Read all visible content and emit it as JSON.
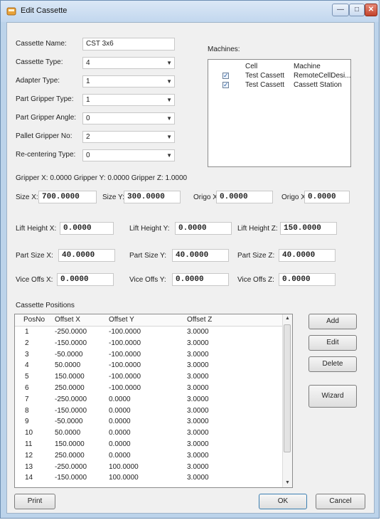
{
  "window": {
    "title": "Edit Cassette"
  },
  "fields": {
    "cassette_name": {
      "label": "Cassette Name:",
      "value": "CST 3x6"
    },
    "cassette_type": {
      "label": "Cassette Type:",
      "value": "4"
    },
    "adapter_type": {
      "label": "Adapter Type:",
      "value": "1"
    },
    "part_gripper_type": {
      "label": "Part Gripper Type:",
      "value": "1"
    },
    "part_gripper_angle": {
      "label": "Part Gripper Angle:",
      "value": "0"
    },
    "pallet_gripper_no": {
      "label": "Pallet Gripper No:",
      "value": "2"
    },
    "recentering_type": {
      "label": "Re-centering Type:",
      "value": "0"
    }
  },
  "machines": {
    "label": "Machines:",
    "columns": [
      "Cell",
      "Machine"
    ],
    "rows": [
      {
        "checked": true,
        "cell": "Test Cassett",
        "machine": "RemoteCellDesi..."
      },
      {
        "checked": true,
        "cell": "Test Cassett",
        "machine": "Cassett Station"
      }
    ]
  },
  "gripper_info": "Gripper X: 0.0000  Gripper Y: 0.0000  Gripper Z: 1.0000",
  "size": {
    "size_x": {
      "label": "Size X:",
      "value": "700.0000"
    },
    "size_y": {
      "label": "Size Y:",
      "value": "300.0000"
    },
    "origo_x": {
      "label": "Origo X:",
      "value": "0.0000"
    },
    "origo_x2": {
      "label": "Origo X:",
      "value": "0.0000"
    }
  },
  "lift": {
    "x": {
      "label": "Lift Height X:",
      "value": "0.0000"
    },
    "y": {
      "label": "Lift Height Y:",
      "value": "0.0000"
    },
    "z": {
      "label": "Lift Height Z:",
      "value": "150.0000"
    }
  },
  "part_size": {
    "x": {
      "label": "Part Size X:",
      "value": "40.0000"
    },
    "y": {
      "label": "Part Size Y:",
      "value": "40.0000"
    },
    "z": {
      "label": "Part Size Z:",
      "value": "40.0000"
    }
  },
  "vice": {
    "x": {
      "label": "Vice Offs X:",
      "value": "0.0000"
    },
    "y": {
      "label": "Vice Offs Y:",
      "value": "0.0000"
    },
    "z": {
      "label": "Vice Offs Z:",
      "value": "0.0000"
    }
  },
  "positions": {
    "label": "Cassette Positions",
    "columns": [
      "PosNo",
      "Offset X",
      "Offset Y",
      "Offset Z"
    ],
    "rows": [
      [
        "1",
        "-250.0000",
        "-100.0000",
        "3.0000"
      ],
      [
        "2",
        "-150.0000",
        "-100.0000",
        "3.0000"
      ],
      [
        "3",
        "-50.0000",
        "-100.0000",
        "3.0000"
      ],
      [
        "4",
        "50.0000",
        "-100.0000",
        "3.0000"
      ],
      [
        "5",
        "150.0000",
        "-100.0000",
        "3.0000"
      ],
      [
        "6",
        "250.0000",
        "-100.0000",
        "3.0000"
      ],
      [
        "7",
        "-250.0000",
        "0.0000",
        "3.0000"
      ],
      [
        "8",
        "-150.0000",
        "0.0000",
        "3.0000"
      ],
      [
        "9",
        "-50.0000",
        "0.0000",
        "3.0000"
      ],
      [
        "10",
        "50.0000",
        "0.0000",
        "3.0000"
      ],
      [
        "11",
        "150.0000",
        "0.0000",
        "3.0000"
      ],
      [
        "12",
        "250.0000",
        "0.0000",
        "3.0000"
      ],
      [
        "13",
        "-250.0000",
        "100.0000",
        "3.0000"
      ],
      [
        "14",
        "-150.0000",
        "100.0000",
        "3.0000"
      ]
    ]
  },
  "buttons": {
    "add": "Add",
    "edit": "Edit",
    "delete": "Delete",
    "wizard": "Wizard",
    "print": "Print",
    "ok": "OK",
    "cancel": "Cancel"
  },
  "title_buttons": {
    "minimize": "—",
    "maximize": "□",
    "close": "✕"
  }
}
